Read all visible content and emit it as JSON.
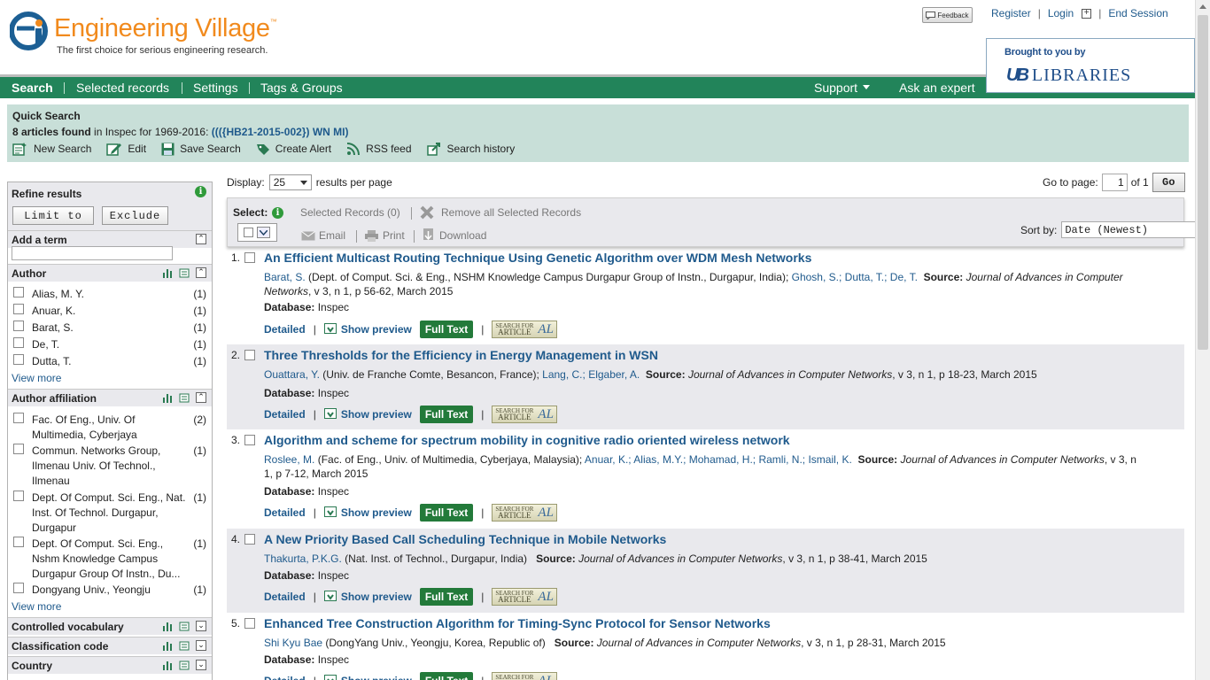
{
  "header": {
    "logo_title": "Engineering Village",
    "logo_tm": "™",
    "tagline": "The first choice for serious engineering research.",
    "feedback": "Feedback",
    "register": "Register",
    "login": "Login",
    "end_session": "End Session",
    "brought_by": "Brought to you by",
    "ub_mark": "UB",
    "ub_text": "LIBRARIES"
  },
  "nav": {
    "search": "Search",
    "selected_records": "Selected records",
    "settings": "Settings",
    "tags_groups": "Tags & Groups",
    "support": "Support",
    "ask_expert": "Ask an expert"
  },
  "quick_search": {
    "title": "Quick Search",
    "count": "8 articles found",
    "in_text": " in Inspec for 1969-2016: ",
    "query": "((({HB21-2015-002}) WN MI)",
    "tools": {
      "new_search": "New Search",
      "edit": "Edit",
      "save_search": "Save Search",
      "create_alert": "Create Alert",
      "rss": "RSS feed",
      "history": "Search history"
    }
  },
  "sidebar": {
    "title": "Refine results",
    "limit": "Limit to",
    "exclude": "Exclude",
    "add_term": "Add a term",
    "view_more": "View more",
    "author": {
      "label": "Author",
      "items": [
        {
          "name": "Alias, M. Y.",
          "count": "(1)"
        },
        {
          "name": "Anuar, K.",
          "count": "(1)"
        },
        {
          "name": "Barat, S.",
          "count": "(1)"
        },
        {
          "name": "De, T.",
          "count": "(1)"
        },
        {
          "name": "Dutta, T.",
          "count": "(1)"
        }
      ]
    },
    "affiliation": {
      "label": "Author affiliation",
      "items": [
        {
          "name": "Fac. Of Eng., Univ. Of Multimedia, Cyberjaya",
          "count": "(2)"
        },
        {
          "name": "Commun. Networks Group, Ilmenau Univ. Of Technol., Ilmenau",
          "count": "(1)"
        },
        {
          "name": "Dept. Of Comput. Sci. Eng., Nat. Inst. Of Technol. Durgapur, Durgapur",
          "count": "(1)"
        },
        {
          "name": "Dept. Of Comput. Sci. Eng., Nshm Knowledge Campus Durgapur Group Of Instn., Du...",
          "count": "(1)"
        },
        {
          "name": "Dongyang Univ., Yeongju",
          "count": "(1)"
        }
      ]
    },
    "controlled_vocab": "Controlled vocabulary",
    "classification": "Classification code",
    "country": "Country"
  },
  "display": {
    "label": "Display:",
    "value": "25",
    "suffix": "results per page",
    "goto": "Go to page:",
    "page": "1",
    "of": "of 1",
    "go": "Go"
  },
  "toolbar": {
    "select": "Select:",
    "selected_records": "Selected Records (0)",
    "remove_all": "Remove all Selected Records",
    "email": "Email",
    "print": "Print",
    "download": "Download",
    "sort_by": "Sort by:",
    "sort_value": "Date (Newest)"
  },
  "labels": {
    "source": "Source:",
    "database": "Database:",
    "detailed": "Detailed",
    "show_preview": "Show preview",
    "full_text": "Full Text",
    "sfa_line1": "SEARCH FOR",
    "sfa_line2": "ARTICLE",
    "sfa_al": "AL"
  },
  "results": [
    {
      "num": "1.",
      "title": "An Efficient Multicast Routing Technique Using Genetic Algorithm over WDM Mesh Networks",
      "authors_lead": "Barat, S.",
      "affil": " (Dept. of Comput. Sci. & Eng., NSHM Knowledge Campus Durgapur Group of Instn., Durgapur, India); ",
      "authors_rest": "Ghosh, S.; Dutta, T.; De, T.",
      "source_journal": "Journal of Advances in Computer Networks",
      "source_rest": ", v 3, n 1, p 56-62, March 2015",
      "database": "Inspec"
    },
    {
      "num": "2.",
      "title": "Three Thresholds for the Efficiency in Energy Management in WSN",
      "authors_lead": "Ouattara, Y.",
      "affil": " (Univ. de Franche Comte, Besancon, France); ",
      "authors_rest": "Lang, C.; Elgaber, A.",
      "source_journal": "Journal of Advances in Computer Networks",
      "source_rest": ", v 3, n 1, p 18-23, March 2015",
      "database": "Inspec"
    },
    {
      "num": "3.",
      "title": "Algorithm and scheme for spectrum mobility in cognitive radio oriented wireless network",
      "authors_lead": "Roslee, M.",
      "affil": " (Fac. of Eng., Univ. of Multimedia, Cyberjaya, Malaysia); ",
      "authors_rest": "Anuar, K.; Alias, M.Y.; Mohamad, H.; Ramli, N.; Ismail, K.",
      "source_journal": "Journal of Advances in Computer Networks",
      "source_rest": ", v 3, n 1, p 7-12, March 2015",
      "database": "Inspec"
    },
    {
      "num": "4.",
      "title": "A New Priority Based Call Scheduling Technique in Mobile Networks",
      "authors_lead": "Thakurta, P.K.G.",
      "affil": " (Nat. Inst. of Technol., Durgapur, India) ",
      "authors_rest": "",
      "source_journal": "Journal of Advances in Computer Networks",
      "source_rest": ", v 3, n 1, p 38-41, March 2015",
      "database": "Inspec"
    },
    {
      "num": "5.",
      "title": "Enhanced Tree Construction Algorithm for Timing-Sync Protocol for Sensor Networks",
      "authors_lead": "Shi Kyu Bae",
      "affil": " (DongYang Univ., Yeongju, Korea, Republic of) ",
      "authors_rest": "",
      "source_journal": "Journal of Advances in Computer Networks",
      "source_rest": ", v 3, n 1, p 28-31, March 2015",
      "database": "Inspec"
    }
  ],
  "colors": {
    "nav_green": "#22845a",
    "panel_green": "#c8dfd8",
    "link_blue": "#1f5a8c",
    "logo_orange": "#f18a1d",
    "fulltext_green": "#237a3a"
  }
}
